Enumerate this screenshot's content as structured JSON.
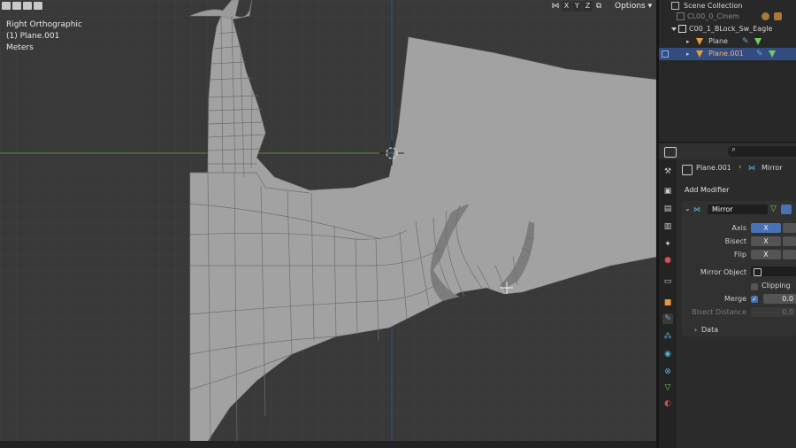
{
  "viewport": {
    "info_lines": [
      "Right Orthographic",
      "(1) Plane.001",
      "Meters"
    ],
    "axis_buttons": [
      "X",
      "Y",
      "Z"
    ],
    "options_label": "Options"
  },
  "outliner": {
    "rows": [
      {
        "label": "Scene Collection",
        "selected": false,
        "indent": 0,
        "icon": "scene-collection-icon",
        "dim": false
      },
      {
        "label": "CL00_0_Cinem",
        "selected": false,
        "indent": 1,
        "icon": "collection-icon",
        "dim": true
      },
      {
        "label": "C00_1_BLock_Sw_Eagle",
        "selected": false,
        "indent": 1,
        "icon": "collection-icon",
        "dim": false
      },
      {
        "label": "Plane",
        "selected": false,
        "indent": 2,
        "icon": "mesh-object-icon",
        "dim": false
      },
      {
        "label": "Plane.001",
        "selected": true,
        "indent": 2,
        "icon": "mesh-object-icon",
        "dim": false
      }
    ]
  },
  "properties": {
    "breadcrumb_object": "Plane.001",
    "breadcrumb_modifier": "Mirror",
    "add_modifier_label": "Add Modifier",
    "modifier_name": "Mirror",
    "axis_label": "Axis",
    "bisect_label": "Bisect",
    "flip_label": "Flip",
    "axis_value": "X",
    "bisect_value": "X",
    "flip_value": "X",
    "mirror_object_label": "Mirror Object",
    "clipping_label": "Clipping",
    "merge_label": "Merge",
    "merge_value": "0.0",
    "bisect_distance_label": "Bisect Distance",
    "bisect_distance_value": "0.0",
    "data_label": "Data"
  },
  "colors": {
    "selection": "#334d80",
    "accent_blue": "#4772b3",
    "mesh_orange": "#e89a3c",
    "modifier_cyan": "#58b4d8",
    "data_green": "#6fcf5f"
  }
}
